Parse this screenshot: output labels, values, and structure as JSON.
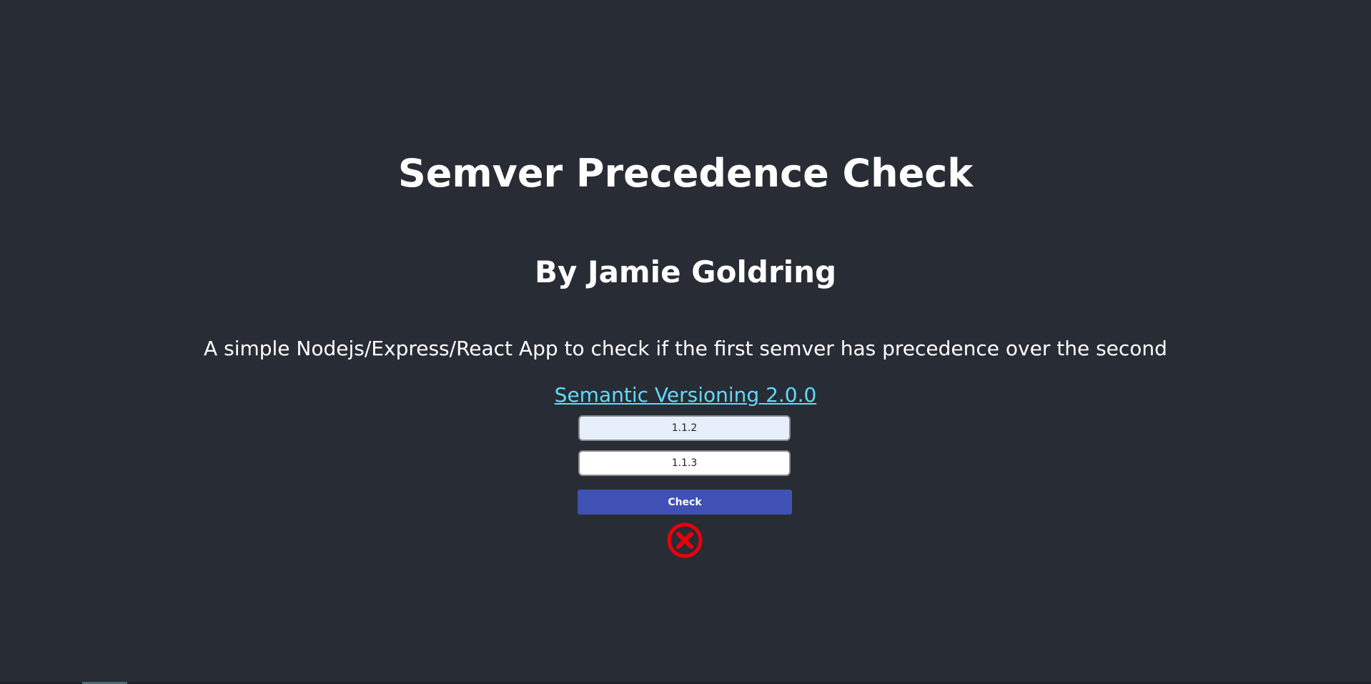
{
  "header": {
    "title": "Semver Precedence Check",
    "author": "By Jamie Goldring",
    "description": "A simple Nodejs/Express/React App to check if the first semver has precedence over the second",
    "link_text": "Semantic Versioning 2.0.0"
  },
  "form": {
    "first_version_value": "1.1.2",
    "second_version_value": "1.1.3",
    "check_label": "Check"
  },
  "result": {
    "icon": "x-circle-icon",
    "status": "false",
    "color": "#e8000b"
  },
  "colors": {
    "background": "#282c34",
    "link": "#61dafb",
    "button": "#3f51b5"
  }
}
